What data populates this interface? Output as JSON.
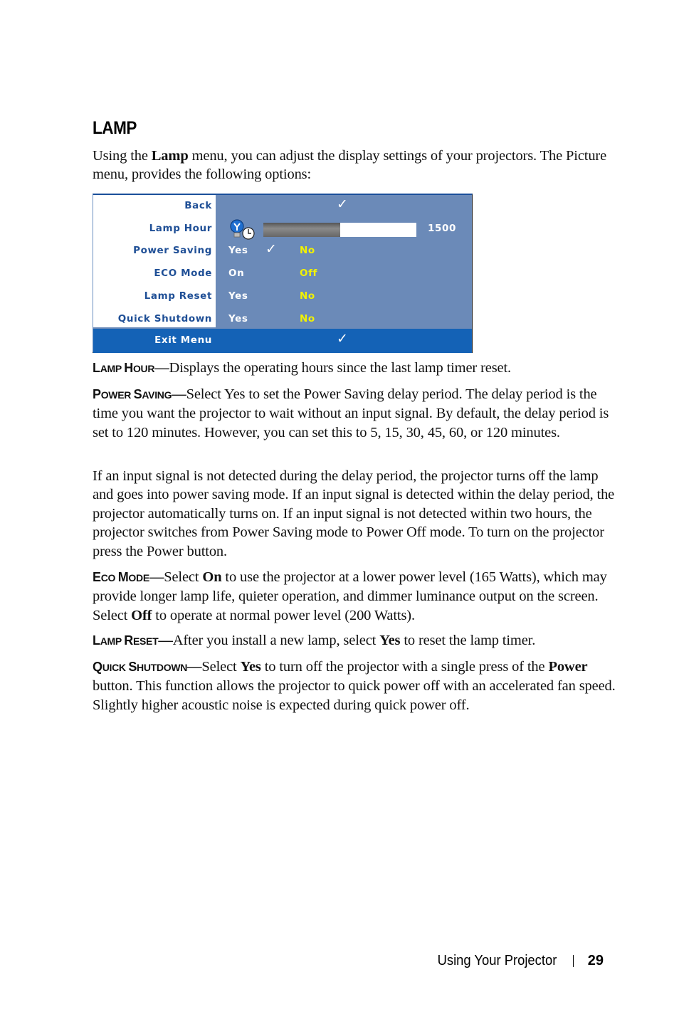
{
  "heading": "LAMP",
  "intro": {
    "t1": "Using the ",
    "b1": "Lamp",
    "t2": " menu, you can adjust the display settings of your projectors. The Picture menu, provides the following options:"
  },
  "osd_menu": {
    "rows": [
      {
        "label": "Back",
        "check": "✓"
      },
      {
        "label": "Lamp Hour",
        "icon": "lamp-clock-icon",
        "progress_fraction": 0.5,
        "value": "1500"
      },
      {
        "label": "Power Saving",
        "option1": "Yes",
        "option1_check": "✓",
        "option2": "No"
      },
      {
        "label": "ECO Mode",
        "option1": "On",
        "option2": "Off"
      },
      {
        "label": "Lamp Reset",
        "option1": "Yes",
        "option2": "No"
      },
      {
        "label": "Quick Shutdown",
        "option1": "Yes",
        "option2": "No"
      }
    ],
    "exit": {
      "label": "Exit Menu",
      "check": "✓"
    },
    "colors": {
      "panel": "#6b8ab8",
      "label_text": "#1f4f96",
      "highlight": "#1462b6",
      "option_selected": "#f2f200"
    }
  },
  "sections": {
    "lamp_hour": {
      "term_cap1": "L",
      "term_rest1": "AMP ",
      "term_cap2": "H",
      "term_rest2": "OUR",
      "dash": "—",
      "text": "Displays the operating hours since the last lamp timer reset."
    },
    "power_saving": {
      "term_cap1": "P",
      "term_rest1": "OWER ",
      "term_cap2": "S",
      "term_rest2": "AVING",
      "dash": "—",
      "text": "Select Yes to set the Power Saving delay period. The delay period is the time you want the projector to wait without an input signal. By default, the delay period is set to 120 minutes. However, you can set this to 5, 15, 30, 45, 60, or 120 minutes."
    },
    "power_saving_detail": "If an input signal is not detected during the delay period, the projector turns off the lamp and goes into power saving mode. If an input signal is detected within the delay period, the projector automatically turns on. If an input signal is not detected within two hours, the projector switches from Power Saving mode to Power Off mode. To turn on the projector press the Power button.",
    "eco_mode": {
      "term_cap1": "E",
      "term_rest1": "CO ",
      "term_cap2": "M",
      "term_rest2": "ODE",
      "dash": "—",
      "t1": "Select ",
      "b1": "On",
      "t2": " to use the projector at a lower power level (165 Watts), which may provide longer lamp life, quieter operation, and dimmer luminance output on the screen. Select ",
      "b2": "Off",
      "t3": " to operate at normal power level (200 Watts)."
    },
    "lamp_reset": {
      "term_cap1": "L",
      "term_rest1": "AMP ",
      "term_cap2": "R",
      "term_rest2": "ESET",
      "dash": "—",
      "t1": "After you install a new lamp, select ",
      "b1": "Yes",
      "t2": " to reset the lamp timer."
    },
    "quick_shutdown": {
      "term_cap1": "Q",
      "term_rest1": "UICK ",
      "term_cap2": "S",
      "term_rest2": "HUTDOWN",
      "dash": "—",
      "t1": "Select ",
      "b1": "Yes",
      "t2": " to turn off the projector with a single press of the ",
      "b2": "Power",
      "t3": " button. This function allows the projector to quick power off with an accelerated fan speed. Slightly higher acoustic noise is expected during quick power off."
    }
  },
  "footer": {
    "section": "Using Your Projector",
    "page": "29"
  }
}
